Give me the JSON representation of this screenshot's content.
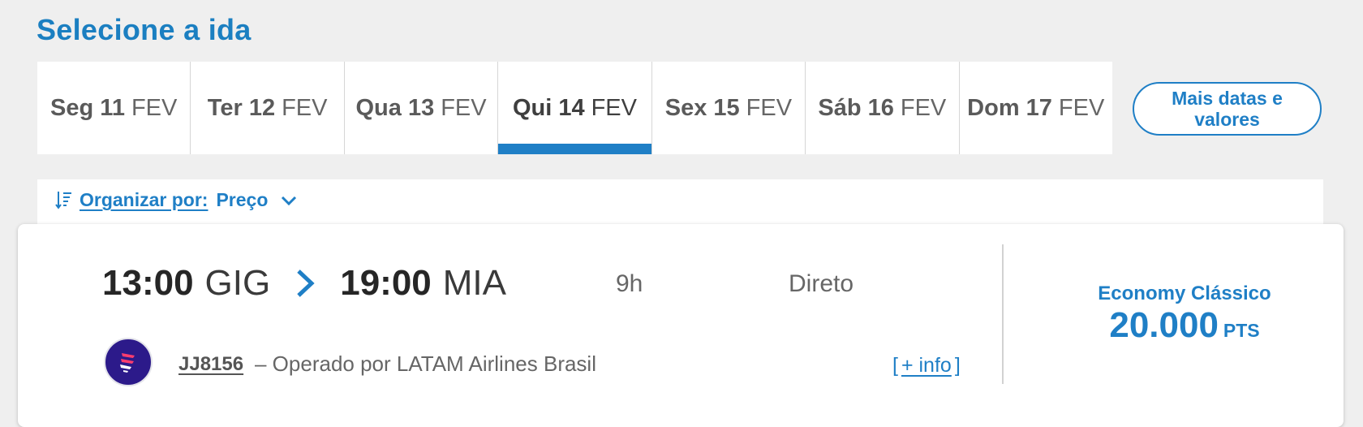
{
  "page": {
    "title": "Selecione a ida"
  },
  "date_tabs": [
    {
      "day": "Seg 11",
      "month": "FEV",
      "selected": false
    },
    {
      "day": "Ter 12",
      "month": "FEV",
      "selected": false
    },
    {
      "day": "Qua 13",
      "month": "FEV",
      "selected": false
    },
    {
      "day": "Qui 14",
      "month": "FEV",
      "selected": true
    },
    {
      "day": "Sex 15",
      "month": "FEV",
      "selected": false
    },
    {
      "day": "Sáb 16",
      "month": "FEV",
      "selected": false
    },
    {
      "day": "Dom 17",
      "month": "FEV",
      "selected": false
    }
  ],
  "more_dates": {
    "label": "Mais datas e valores"
  },
  "sort": {
    "label": "Organizar por:",
    "value": "Preço",
    "icon": "sort-icon"
  },
  "flight": {
    "departure_time": "13:00",
    "origin": "GIG",
    "arrival_time": "19:00",
    "destination": "MIA",
    "duration": "9h",
    "stops": "Direto",
    "flight_number": "JJ8156",
    "operator": "– Operado por LATAM Airlines Brasil",
    "more_info": {
      "open": "[",
      "label": "+ info",
      "close": "]"
    },
    "airline_logo_icon": "latam-logo",
    "fare": {
      "class": "Economy Clássico",
      "amount": "20.000",
      "unit": "PTS"
    }
  },
  "colors": {
    "accent": "#1f7fc6",
    "title": "#1b7fc1",
    "logo": "#2c1a8a",
    "background": "#efefef"
  }
}
